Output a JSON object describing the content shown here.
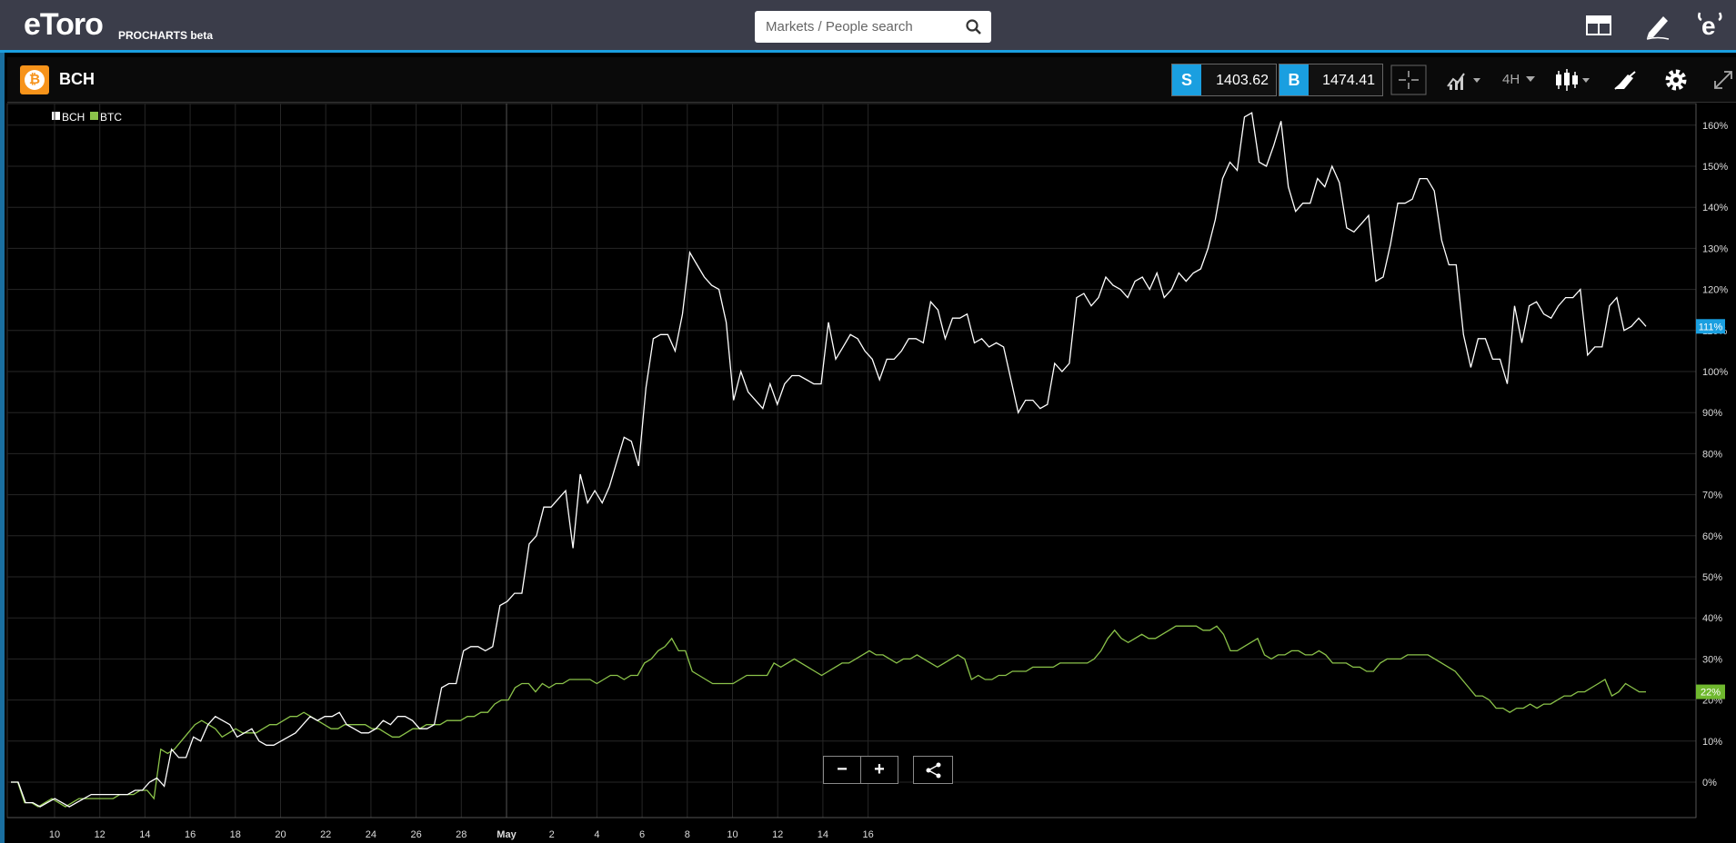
{
  "header": {
    "logo": "eToro",
    "sub": "PROCHARTS beta",
    "search_placeholder": "Markets / People search",
    "icons": [
      "search-icon",
      "layout-icon",
      "pencil-icon",
      "etoro-e-icon"
    ]
  },
  "instrument": {
    "symbol": "BCH",
    "sell_label": "S",
    "sell_price": "1403.62",
    "buy_label": "B",
    "buy_price": "1474.41",
    "timeframe": "4H",
    "icons": [
      "bitcoin-icon",
      "crosshair-icon",
      "chart-type-icon",
      "candlestick-icon",
      "drawing-icon",
      "gear-icon",
      "fullscreen-icon"
    ]
  },
  "colors": {
    "bch": "#ffffff",
    "btc": "#8bc34a",
    "accent": "#1a9fe0",
    "grid": "#2a2a2a"
  },
  "chart_data": {
    "type": "line",
    "title": "",
    "legend": [
      "BCH",
      "BTC"
    ],
    "legend_position": "top-left",
    "x_ticks": [
      "10",
      "12",
      "14",
      "16",
      "18",
      "20",
      "22",
      "24",
      "26",
      "28",
      "May",
      "2",
      "4",
      "6",
      "8",
      "10",
      "12",
      "14",
      "16"
    ],
    "y_ticks": [
      "0%",
      "10%",
      "20%",
      "30%",
      "40%",
      "50%",
      "60%",
      "70%",
      "80%",
      "90%",
      "100%",
      "110%",
      "120%",
      "130%",
      "140%",
      "150%",
      "160%"
    ],
    "ylim": [
      -8,
      164
    ],
    "grid": true,
    "series": [
      {
        "name": "BCH",
        "last_label": "111%",
        "values": [
          0,
          0,
          -5,
          -5,
          -6,
          -5,
          -4,
          -5,
          -6,
          -5,
          -4,
          -3,
          -3,
          -3,
          -3,
          -3,
          -3,
          -2,
          -2,
          0,
          1,
          -1,
          8,
          6,
          6,
          11,
          10,
          14,
          16,
          15,
          14,
          11,
          12,
          13,
          10,
          9,
          9,
          10,
          11,
          12,
          14,
          16,
          15,
          16,
          16,
          17,
          14,
          13,
          12,
          12,
          13,
          15,
          14,
          16,
          16,
          15,
          13,
          13,
          14,
          23,
          24,
          24,
          32,
          33,
          33,
          32,
          33,
          43,
          44,
          46,
          46,
          58,
          60,
          67,
          67,
          69,
          71,
          57,
          75,
          68,
          71,
          68,
          72,
          78,
          84,
          83,
          77,
          96,
          108,
          109,
          109,
          105,
          114,
          129,
          126,
          123,
          121,
          120,
          112,
          93,
          100,
          95,
          93,
          91,
          97,
          92,
          97,
          99,
          99,
          98,
          97,
          97,
          112,
          103,
          106,
          109,
          108,
          105,
          103,
          98,
          103,
          103,
          105,
          108,
          108,
          107,
          117,
          115,
          108,
          113,
          113,
          114,
          107,
          108,
          106,
          107,
          106,
          98,
          90,
          93,
          93,
          91,
          92,
          102,
          100,
          102,
          118,
          119,
          116,
          118,
          123,
          121,
          120,
          118,
          122,
          123,
          120,
          124,
          118,
          120,
          124,
          122,
          124,
          125,
          130,
          137,
          147,
          151,
          149,
          162,
          163,
          151,
          150,
          155,
          161,
          145,
          139,
          141,
          141,
          147,
          145,
          150,
          146,
          135,
          134,
          136,
          138,
          122,
          123,
          131,
          141,
          141,
          142,
          147,
          147,
          144,
          132,
          126,
          126,
          109,
          101,
          108,
          108,
          103,
          103,
          97,
          116,
          107,
          116,
          117,
          114,
          113,
          116,
          118,
          118,
          120,
          104,
          106,
          106,
          116,
          118,
          110,
          111,
          113,
          111
        ]
      },
      {
        "name": "BTC",
        "last_label": "22%",
        "values": [
          0,
          0,
          -5,
          -5,
          -6,
          -5,
          -4,
          -5,
          -6,
          -5,
          -4,
          -4,
          -4,
          -4,
          -4,
          -4,
          -3,
          -3,
          -3,
          -2,
          -2,
          -4,
          8,
          7,
          8,
          10,
          12,
          14,
          15,
          14,
          13,
          11,
          12,
          13,
          12,
          12,
          12,
          13,
          14,
          14,
          15,
          16,
          16,
          17,
          16,
          15,
          14,
          13,
          13,
          14,
          14,
          14,
          14,
          13,
          13,
          12,
          11,
          11,
          12,
          13,
          13,
          14,
          14,
          14,
          15,
          15,
          15,
          16,
          16,
          17,
          17,
          19,
          20,
          20,
          23,
          24,
          24,
          22,
          24,
          23,
          24,
          24,
          25,
          25,
          25,
          25,
          24,
          25,
          26,
          26,
          25,
          26,
          26,
          29,
          30,
          32,
          33,
          35,
          32,
          32,
          27,
          26,
          25,
          24,
          24,
          24,
          24,
          25,
          26,
          26,
          26,
          26,
          29,
          28,
          29,
          30,
          29,
          28,
          27,
          26,
          27,
          28,
          29,
          29,
          30,
          31,
          32,
          31,
          31,
          30,
          29,
          30,
          30,
          31,
          30,
          29,
          28,
          29,
          30,
          31,
          30,
          25,
          26,
          25,
          25,
          26,
          26,
          27,
          27,
          27,
          28,
          28,
          28,
          28,
          29,
          29,
          29,
          29,
          29,
          30,
          32,
          35,
          37,
          35,
          34,
          35,
          36,
          35,
          35,
          36,
          37,
          38,
          38,
          38,
          38,
          37,
          37,
          38,
          36,
          32,
          32,
          33,
          34,
          35,
          31,
          30,
          31,
          31,
          32,
          32,
          31,
          31,
          32,
          31,
          29,
          29,
          29,
          28,
          28,
          27,
          27,
          29,
          30,
          30,
          30,
          31,
          31,
          31,
          31,
          30,
          29,
          28,
          27,
          25,
          23,
          21,
          21,
          20,
          18,
          18,
          17,
          18,
          18,
          19,
          18,
          19,
          19,
          20,
          21,
          21,
          22,
          22,
          23,
          24,
          25,
          21,
          22,
          24,
          23,
          22,
          22
        ]
      }
    ]
  },
  "controls": {
    "zoom_out": "−",
    "zoom_in": "+",
    "share_icon": "share-icon"
  }
}
